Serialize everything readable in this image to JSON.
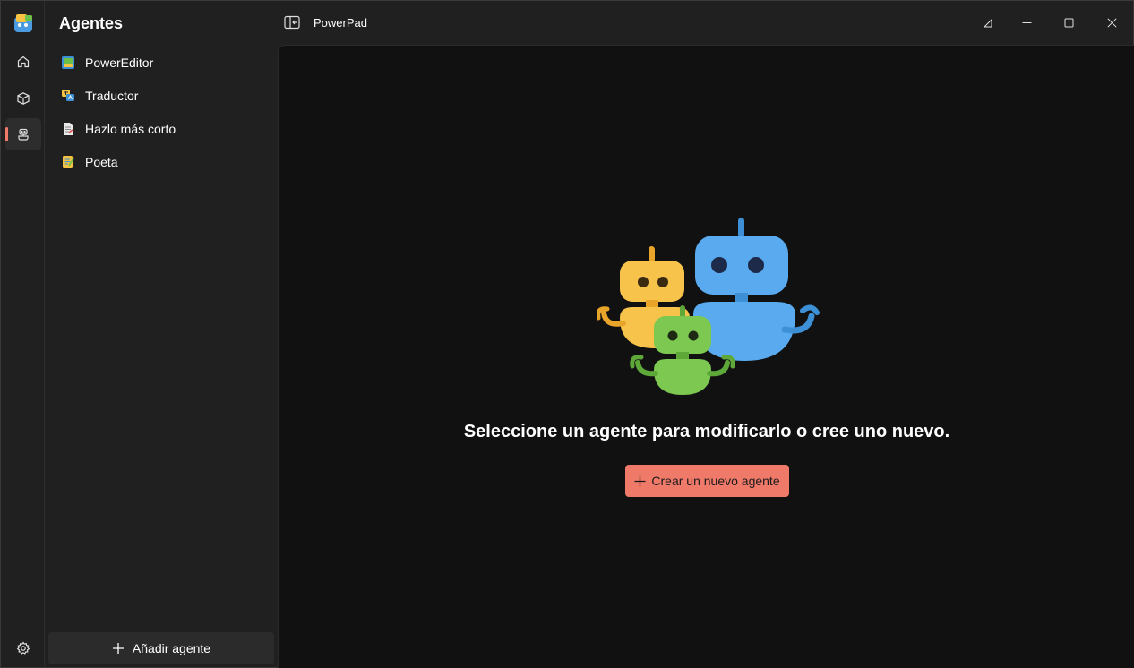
{
  "app": {
    "title": "PowerPad"
  },
  "rail": {
    "items": [
      {
        "name": "home",
        "icon": "home-icon"
      },
      {
        "name": "models",
        "icon": "cube-icon"
      },
      {
        "name": "agents",
        "icon": "robot-icon",
        "active": true
      }
    ],
    "settings_icon": "gear-icon"
  },
  "pane": {
    "title": "Agentes",
    "agents": [
      {
        "label": "PowerEditor",
        "icon": "power-editor-icon"
      },
      {
        "label": "Traductor",
        "icon": "translator-icon"
      },
      {
        "label": "Hazlo más corto",
        "icon": "document-icon"
      },
      {
        "label": "Poeta",
        "icon": "notebook-icon"
      }
    ],
    "add_label": "Añadir agente"
  },
  "main": {
    "empty_message": "Seleccione un agente para modificarlo o cree uno nuevo.",
    "create_label": "Crear un nuevo agente"
  },
  "colors": {
    "accent": "#f07a6a",
    "background": "#202020",
    "content_bg": "#111111"
  }
}
